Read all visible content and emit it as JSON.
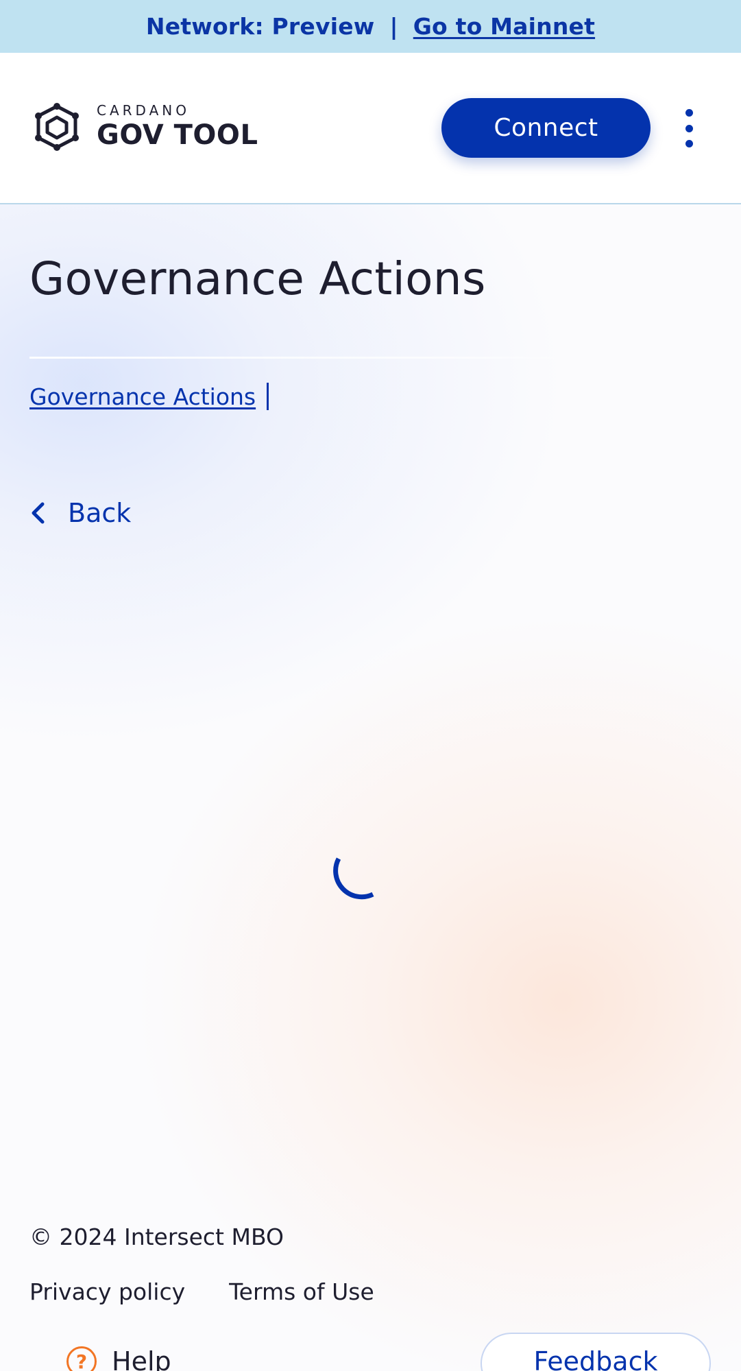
{
  "banner": {
    "network_label": "Network: Preview",
    "separator": "|",
    "mainnet_link": "Go to Mainnet"
  },
  "header": {
    "logo_small": "CARDANO",
    "logo_big": "GOV TOOL",
    "connect_label": "Connect",
    "menu_icon": "kebab-menu-icon"
  },
  "main": {
    "title": "Governance Actions",
    "breadcrumb": {
      "link": "Governance Actions"
    },
    "back_label": "Back",
    "loading_icon": "spinner-icon"
  },
  "footer": {
    "copyright": "© 2024 Intersect MBO",
    "links": [
      "Privacy policy",
      "Terms of Use"
    ],
    "help_label": "Help",
    "help_icon_glyph": "?",
    "feedback_label": "Feedback"
  },
  "colors": {
    "primary": "#0433ad",
    "banner_bg": "#bfe2f1",
    "help_accent": "#f27524",
    "text": "#1e1e2f"
  }
}
